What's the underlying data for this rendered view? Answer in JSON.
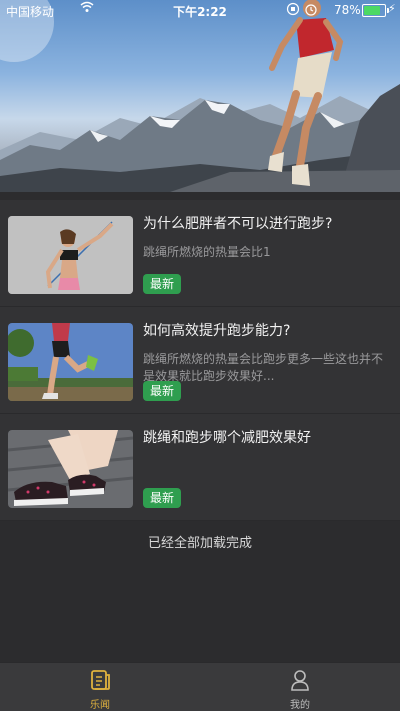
{
  "status_bar": {
    "carrier": "中国移动",
    "time": "下午2:22",
    "battery_percent": "78%",
    "battery_level": 0.78
  },
  "articles": [
    {
      "title": "为什么肥胖者不可以进行跑步?",
      "summary": "跳绳所燃烧的热量会比1",
      "badge": "最新",
      "thumb_icon": "woman-jump-rope-image"
    },
    {
      "title": "如何高效提升跑步能力?",
      "summary": "跳绳所燃烧的热量会比跑步更多一些这也并不是效果就比跑步效果好...",
      "badge": "最新",
      "thumb_icon": "runner-legs-image"
    },
    {
      "title": "跳绳和跑步哪个减肥效果好",
      "summary": "",
      "badge": "最新",
      "thumb_icon": "sneakers-image"
    }
  ],
  "footer_text": "已经全部加载完成",
  "tabs": [
    {
      "label": "乐闻",
      "icon": "news-icon",
      "active": true
    },
    {
      "label": "我的",
      "icon": "profile-icon",
      "active": false
    }
  ],
  "colors": {
    "background": "#2c2c2e",
    "badge": "#2f9e4f",
    "active_tab": "#e0b23e"
  }
}
